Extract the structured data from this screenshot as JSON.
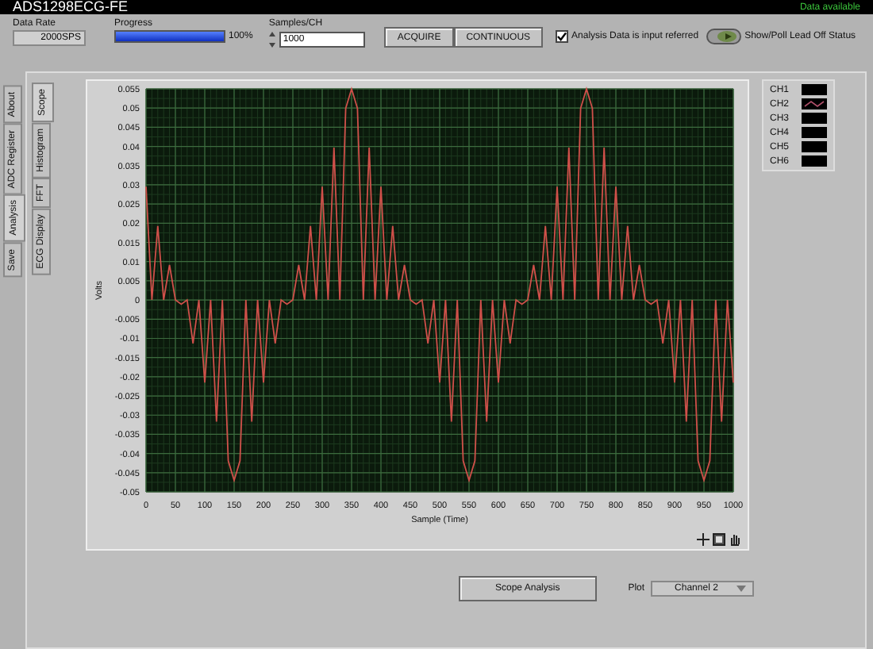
{
  "window": {
    "title": "ADS1298ECG-FE",
    "status": "Data available"
  },
  "controls": {
    "data_rate": {
      "label": "Data Rate",
      "value": "2000SPS"
    },
    "progress": {
      "label": "Progress",
      "level": 1,
      "reading": "100%"
    },
    "samples": {
      "label": "Samples/CH",
      "value": "1000"
    },
    "buttons": [
      "ACQUIRE",
      "CONTINUOUS"
    ],
    "input_referred": {
      "label": "Analysis Data is input referred",
      "checked": true
    },
    "lead_off": {
      "label": "Show/Poll Lead Off Status"
    }
  },
  "outer_tabs": [
    {
      "label": "About",
      "selected": false
    },
    {
      "label": "ADC Register",
      "selected": false
    },
    {
      "label": "Analysis",
      "selected": true
    },
    {
      "label": "Save",
      "selected": false
    }
  ],
  "inner_tabs": [
    {
      "label": "Scope",
      "selected": true
    },
    {
      "label": "Histogram",
      "selected": false
    },
    {
      "label": "FFT",
      "selected": false
    },
    {
      "label": "ECG Display",
      "selected": false
    }
  ],
  "chart": {
    "chart_data": {
      "type": "line",
      "grid": true,
      "xlabel": "Sample (Time)",
      "ylabel": "Volts",
      "xlim": [
        0,
        1000
      ],
      "ylim": [
        -0.05,
        0.055
      ],
      "xticks": [
        0,
        50,
        100,
        150,
        200,
        250,
        300,
        350,
        400,
        450,
        500,
        550,
        600,
        650,
        700,
        750,
        800,
        850,
        900,
        950,
        1000
      ],
      "yticks": [
        {
          "value": 0.055,
          "label": "0.055"
        },
        {
          "value": 0.05,
          "label": "0.05"
        },
        {
          "value": 0.045,
          "label": "0.045"
        },
        {
          "value": 0.04,
          "label": "0.04"
        },
        {
          "value": 0.035,
          "label": "0.035"
        },
        {
          "value": 0.03,
          "label": "0.03"
        },
        {
          "value": 0.025,
          "label": "0.025"
        },
        {
          "value": 0.02,
          "label": "0.02"
        },
        {
          "value": 0.015,
          "label": "0.015"
        },
        {
          "value": 0.01,
          "label": "0.01"
        },
        {
          "value": 0.005,
          "label": "0.005"
        },
        {
          "value": 0,
          "label": "0"
        },
        {
          "value": -0.005,
          "label": "-0.005"
        },
        {
          "value": -0.01,
          "label": "-0.01"
        },
        {
          "value": -0.015,
          "label": "-0.015"
        },
        {
          "value": -0.02,
          "label": "-0.02"
        },
        {
          "value": -0.025,
          "label": "-0.025"
        },
        {
          "value": -0.03,
          "label": "-0.03"
        },
        {
          "value": -0.035,
          "label": "-0.035"
        },
        {
          "value": -0.04,
          "label": "-0.04"
        },
        {
          "value": -0.045,
          "label": "-0.045"
        },
        {
          "value": -0.05,
          "label": "-0.05"
        }
      ],
      "x": [
        0,
        10,
        20,
        30,
        40,
        50,
        60,
        70,
        80,
        90,
        100,
        110,
        120,
        130,
        140,
        150,
        160,
        170,
        180,
        190,
        200,
        210,
        220,
        230,
        240,
        250,
        260,
        270,
        280,
        290,
        300,
        310,
        320,
        330,
        340,
        350,
        360,
        370,
        380,
        390,
        400,
        410,
        420,
        430,
        440,
        450,
        460,
        470,
        480,
        490,
        500,
        510,
        520,
        530,
        540,
        550,
        560,
        570,
        580,
        590,
        600,
        610,
        620,
        630,
        640,
        650,
        660,
        670,
        680,
        690,
        700,
        710,
        720,
        730,
        740,
        750,
        760,
        770,
        780,
        790,
        800,
        810,
        820,
        830,
        840,
        850,
        860,
        870,
        880,
        890,
        900,
        910,
        920,
        930,
        940,
        950,
        960,
        970,
        980,
        990,
        1000
      ],
      "series": [
        {
          "color": "#d0504a",
          "values": [
            0.0295,
            0,
            0.0193,
            0,
            0.0091,
            0,
            -0.0011,
            0,
            -0.0113,
            0,
            -0.0215,
            0,
            -0.0317,
            0,
            -0.0419,
            -0.047,
            -0.0419,
            0,
            -0.0317,
            0,
            -0.0215,
            0,
            -0.0113,
            0,
            -0.0011,
            0,
            0.0091,
            0,
            0.0193,
            0,
            0.0295,
            0,
            0.0397,
            0,
            0.0499,
            0.055,
            0.0499,
            0,
            0.0397,
            0,
            0.0295,
            0,
            0.0193,
            0,
            0.0091,
            0,
            -0.0011,
            0,
            -0.0113,
            0,
            -0.0215,
            0,
            -0.0317,
            0,
            -0.0419,
            -0.047,
            -0.0419,
            0,
            -0.0317,
            0,
            -0.0215,
            0,
            -0.0113,
            0,
            -0.0011,
            0,
            0.0091,
            0,
            0.0193,
            0,
            0.0295,
            0,
            0.0397,
            0,
            0.0499,
            0.055,
            0.0499,
            0,
            0.0397,
            0,
            0.0295,
            0,
            0.0193,
            0,
            0.0091,
            0,
            -0.0011,
            0,
            -0.0113,
            0,
            -0.0215,
            0,
            -0.0317,
            0,
            -0.0419,
            -0.047,
            -0.0419,
            0,
            -0.0317,
            0,
            -0.0215
          ]
        }
      ]
    }
  },
  "legend": [
    {
      "label": "CH1",
      "plotted": false
    },
    {
      "label": "CH2",
      "plotted": true
    },
    {
      "label": "CH3",
      "plotted": false
    },
    {
      "label": "CH4",
      "plotted": false
    },
    {
      "label": "CH5",
      "plotted": false
    },
    {
      "label": "CH6",
      "plotted": false
    }
  ],
  "scope_analysis_button": "Scope Analysis",
  "plot_select": {
    "label": "Plot",
    "value": "Channel 2"
  }
}
